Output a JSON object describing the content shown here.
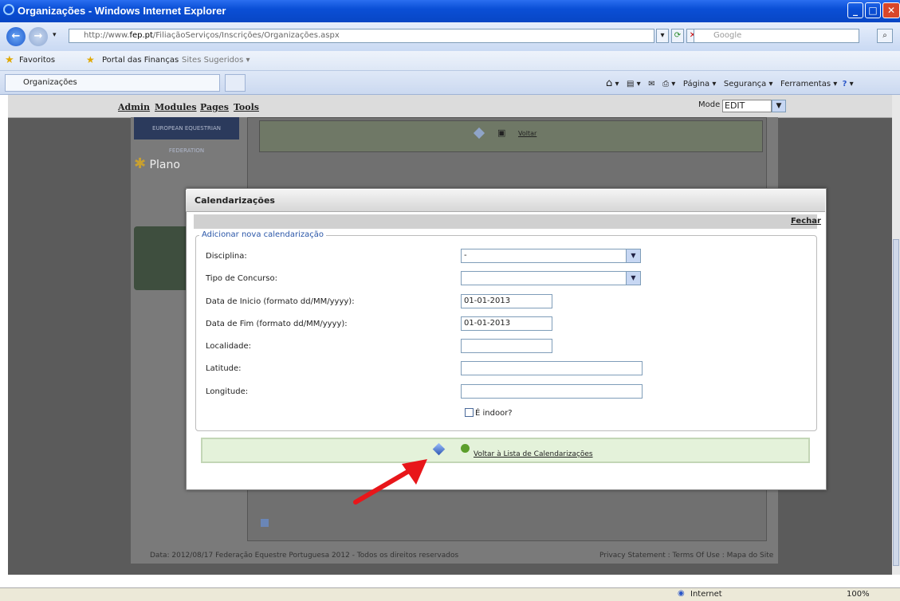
{
  "window": {
    "title": "Organizações - Windows Internet Explorer",
    "address": "http://www.fep.pt/FiliaçãoServiços/Inscrições/Organizações.aspx",
    "address_prefix": "http://www.",
    "address_domain": "fep.pt",
    "address_path": "/FiliaçãoServiços/Inscrições/Organizações.aspx",
    "search_placeholder": "Google",
    "favorites_label": "Favoritos",
    "fav_items": [
      "Portal das Finanças",
      "Sites Sugeridos ▾"
    ],
    "tab_label": "Organizações",
    "commands": [
      "Página ▾",
      "Segurança ▾",
      "Ferramentas ▾"
    ],
    "status_zone": "Internet",
    "zoom": "100%"
  },
  "admin_bar": {
    "links": [
      "Admin",
      "Modules",
      "Pages",
      "Tools"
    ],
    "mode_label": "Mode",
    "mode_value": "EDIT"
  },
  "background_page": {
    "logo_text": "EUROPEAN EQUESTRIAN FEDERATION",
    "plano_text": "Plano",
    "voltar": "Voltar",
    "footer_left": "Data: 2012/08/17   Federação Equestre Portuguesa 2012 - Todos os direitos reservados",
    "footer_right": "Privacy Statement : Terms Of Use : Mapa do Site"
  },
  "dialog": {
    "title": "Calendarizações",
    "close_label": "Fechar",
    "legend": "Adicionar nova calendarização",
    "fields": {
      "disciplina_label": "Disciplina:",
      "disciplina_value": "-",
      "tipo_label": "Tipo de Concurso:",
      "tipo_value": "",
      "inicio_label": "Data de Inicio (formato dd/MM/yyyy):",
      "inicio_value": "01-01-2013",
      "fim_label": "Data de Fim (formato dd/MM/yyyy):",
      "fim_value": "01-01-2013",
      "localidade_label": "Localidade:",
      "latitude_label": "Latitude:",
      "longitude_label": "Longitude:",
      "indoor_label": "É indoor?"
    },
    "back_link": "Voltar à Lista de Calendarizações"
  },
  "colors": {
    "annotation_arrow": "#e8161a",
    "titlebar": "#0a4fd6",
    "button_bar": "#e4f2da"
  }
}
